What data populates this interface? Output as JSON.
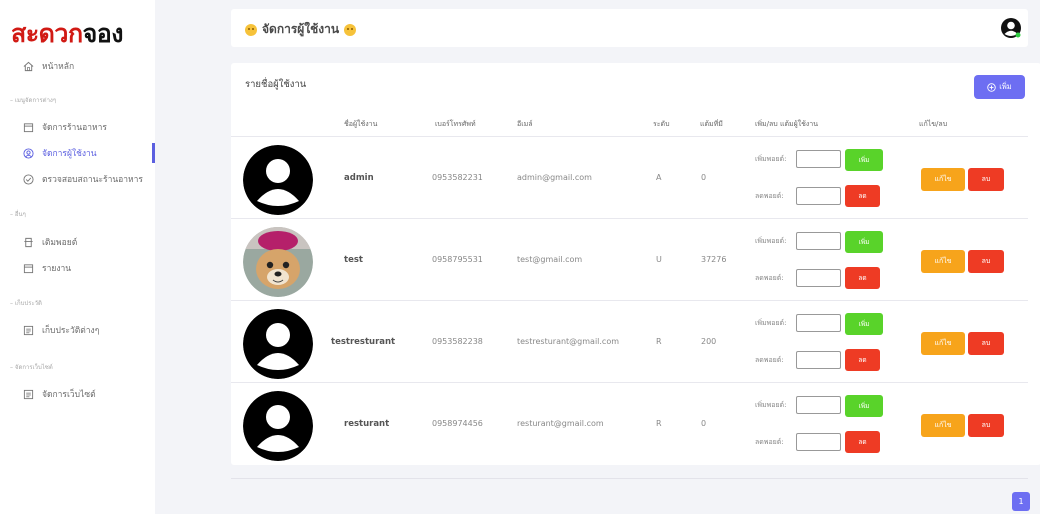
{
  "brand": {
    "part1": "สะดวก",
    "part2": "จอง",
    "color_primary": "#d11a14"
  },
  "sidebar": {
    "home": {
      "label": "หน้าหลัก",
      "icon": "home-icon"
    },
    "sections": [
      {
        "label": "เมนูจัดการต่างๆ"
      },
      {
        "label": "อื่นๆ"
      },
      {
        "label": "เก็บประวัติ"
      },
      {
        "label": "จัดการเว็บไซต์"
      }
    ],
    "items": [
      {
        "label": "จัดการร้านอาหาร",
        "icon": "calendar-icon"
      },
      {
        "label": "จัดการผู้ใช้งาน",
        "icon": "user-circle-icon"
      },
      {
        "label": "ตรวจสอบสถานะร้านอาหาร",
        "icon": "check-circle-icon"
      },
      {
        "label": "เติมพอยต์",
        "icon": "receipt-icon"
      },
      {
        "label": "รายงาน",
        "icon": "calendar-icon"
      },
      {
        "label": "เก็บประวัติต่างๆ",
        "icon": "list-icon"
      },
      {
        "label": "จัดการเว็บไซต์",
        "icon": "list-icon"
      }
    ],
    "active_color": "#5b5fe0"
  },
  "header": {
    "title": "จัดการผู้ใช้งาน"
  },
  "card": {
    "title": "รายชื่อผู้ใช้งาน",
    "add_label": "เพิ่ม",
    "columns": {
      "username": "ชื่อผู้ใช้งาน",
      "phone": "เบอร์โทรศัพท์",
      "email": "อีเมล์",
      "level": "ระดับ",
      "points": "แต้มที่มี",
      "point_action": "เพิ่ม/ลบ แต้มผู้ใช้งาน",
      "edit_delete": "แก้ไข/ลบ"
    },
    "add_point_label": "เพิ่มพอยต์:",
    "sub_point_label": "ลดพอยต์:",
    "btn_add": "เพิ่ม",
    "btn_sub": "ลด",
    "btn_edit": "แก้ไข",
    "btn_delete": "ลบ"
  },
  "users": [
    {
      "username": "admin",
      "phone": "0953582231",
      "email": "admin@gmail.com",
      "level": "A",
      "points": "0",
      "avatar": "default"
    },
    {
      "username": "test",
      "phone": "0958795531",
      "email": "test@gmail.com",
      "level": "U",
      "points": "37276",
      "avatar": "photo"
    },
    {
      "username": "testresturant",
      "phone": "0953582238",
      "email": "testresturant@gmail.com",
      "level": "R",
      "points": "200",
      "avatar": "default"
    },
    {
      "username": "resturant",
      "phone": "0958974456",
      "email": "resturant@gmail.com",
      "level": "R",
      "points": "0",
      "avatar": "default"
    }
  ],
  "pagination": {
    "current": "1"
  }
}
